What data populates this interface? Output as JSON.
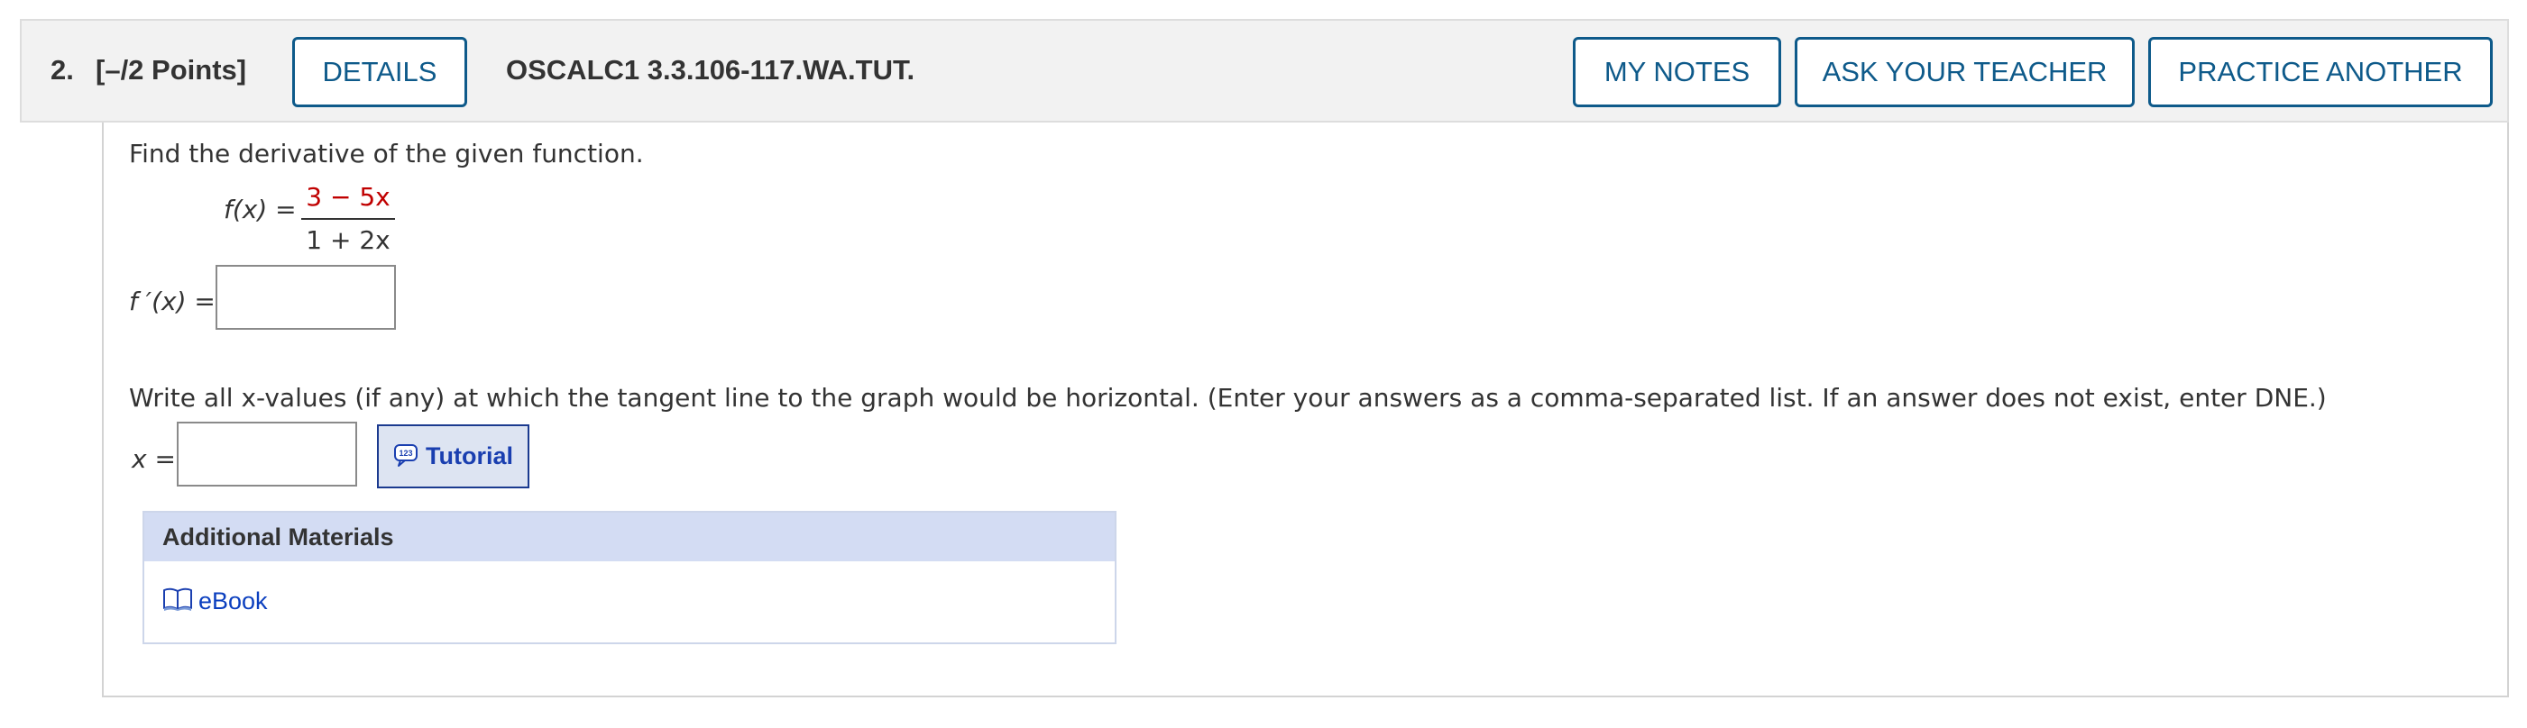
{
  "question": {
    "number": "2.",
    "points": "[–/2 Points]",
    "details_label": "DETAILS",
    "assignment_id": "OSCALC1 3.3.106-117.WA.TUT.",
    "my_notes_label": "MY NOTES",
    "ask_teacher_label": "ASK YOUR TEACHER",
    "practice_another_label": "PRACTICE ANOTHER"
  },
  "body": {
    "prompt": "Find the derivative of the given function.",
    "function_lhs": "f(x) =",
    "numerator": "3 − 5x",
    "denominator": "1 + 2x",
    "derivative_label": "f ′(x) =",
    "derivative_value": "",
    "instruction": "Write all x-values (if any) at which the tangent line to the graph would be horizontal. (Enter your answers as a comma-separated list. If an answer does not exist, enter DNE.)",
    "x_label": "x =",
    "x_value": "",
    "tutorial_label": "Tutorial"
  },
  "materials": {
    "heading": "Additional Materials",
    "ebook_label": "eBook"
  },
  "colors": {
    "accent": "#0e5a8a",
    "numerator": "#c00000",
    "link": "#0b3fbf",
    "materials_header": "#d3dcf3"
  },
  "icons": {
    "tutorial": "calculator-chat-icon",
    "ebook": "open-book-icon"
  }
}
